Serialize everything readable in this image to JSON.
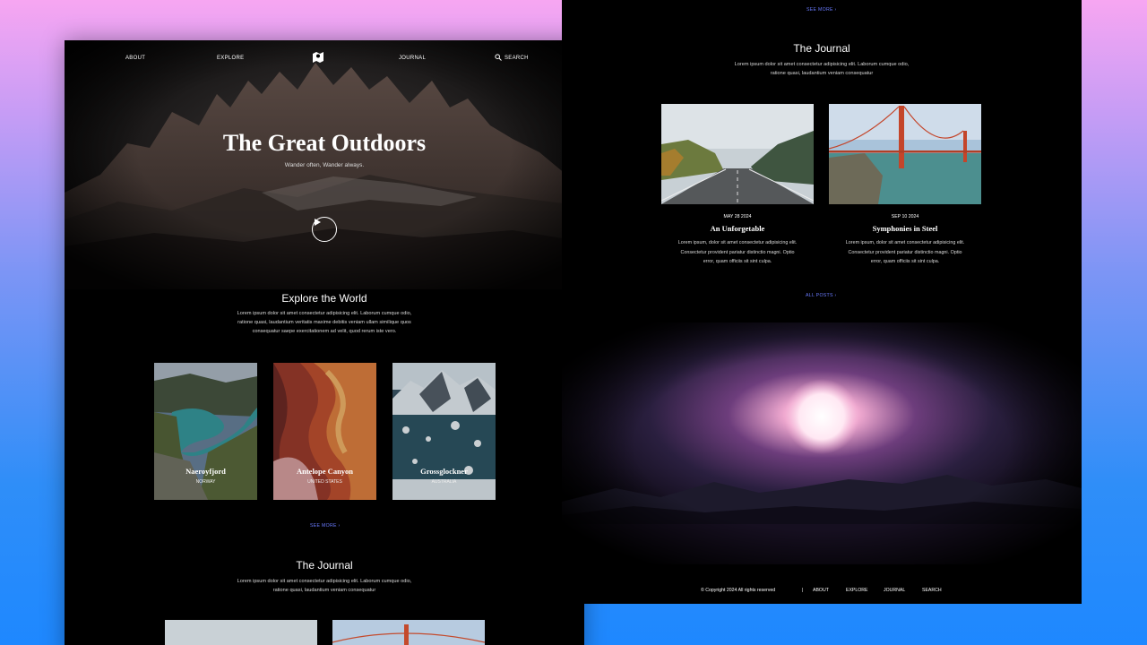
{
  "left_page": {
    "nav": {
      "about": "ABOUT",
      "explore": "EXPLORE",
      "journal": "JOURNAL",
      "search": "SEARCH"
    },
    "hero": {
      "title": "The Great Outdoors",
      "subtitle": "Wander often, Wander always."
    },
    "explore": {
      "title": "Explore the World",
      "body_line1": "Lorem ipsum dolor sit amet consectetur adipisicing elit. Laborum cumque odio,",
      "body_line2": "ratione quasi, laudantium veritatis maxime debitis veniam ullam similique quos",
      "body_line3": "consequatur saepe exercitationem ad velit, quod rerum iste vero.",
      "destinations": [
        {
          "name": "Naeroyfjord",
          "country": "NORWAY"
        },
        {
          "name": "Antelope Canyon",
          "country": "UNITED STATES"
        },
        {
          "name": "Grossglockner",
          "country": "AUSTRALIA"
        }
      ],
      "see_more": "SEE MORE ›"
    },
    "journal": {
      "title": "The Journal",
      "body_line1": "Lorem ipsum dolor sit amet consectetur adipisicing elit. Laborum cumque odio,",
      "body_line2": "ratione quasi, laudantium veniam consequatur"
    }
  },
  "right_page": {
    "see_more": "SEE MORE ›",
    "journal": {
      "title": "The Journal",
      "body_line1": "Lorem ipsum dolor sit amet consectetur adipisicing elit. Laborum cumque odio,",
      "body_line2": "ratione quasi, laudantium veniam consequatur"
    },
    "posts": [
      {
        "date": "MAY 28 2024",
        "title": "An Unforgetable",
        "excerpt_line1": "Lorem ipsum, dolor sit amet consectetur adipisicing elit.",
        "excerpt_line2": "Consectetur provident pariatur distinctio magni. Optio",
        "excerpt_line3": "error, quam officiis sit sint culpa."
      },
      {
        "date": "SEP 10 2024",
        "title": "Symphonies in Steel",
        "excerpt_line1": "Lorem ipsum, dolor sit amet consectetur adipisicing elit.",
        "excerpt_line2": "Consectetur provident pariatur distinctio magni. Optio",
        "excerpt_line3": "error, quam officiis sit sint culpa."
      }
    ],
    "all_posts": "ALL POSTS ›",
    "footer": {
      "copyright": "© Copyright 2024 All rights reserved",
      "separator": "|",
      "about": "ABOUT",
      "explore": "EXPLORE",
      "journal": "JOURNAL",
      "search": "SEARCH"
    }
  },
  "colors": {
    "accent_link": "#6a7bff",
    "page_bg": "#000000",
    "backdrop_top": "#f7a6f2",
    "backdrop_bottom": "#1e88ff"
  }
}
